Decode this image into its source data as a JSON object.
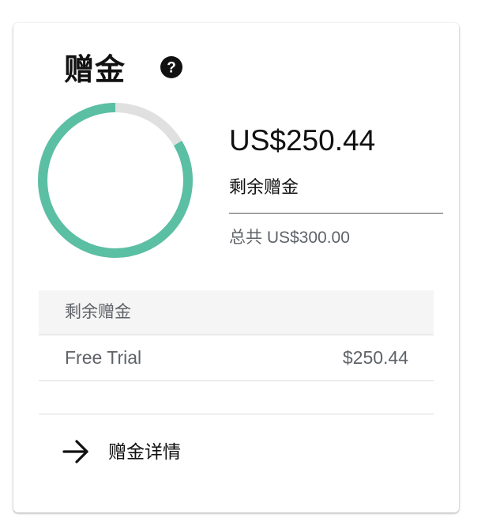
{
  "card": {
    "title": "赠金",
    "help_icon": "help-icon",
    "remaining_amount": "US$250.44",
    "remaining_label": "剩余赠金",
    "total_text": "总共 US$300.00",
    "remaining_fraction": 0.835,
    "colors": {
      "accent": "#5bbfa4",
      "track": "#e0e0e0"
    }
  },
  "table": {
    "header": "剩余赠金",
    "rows": [
      {
        "name": "Free Trial",
        "value": "$250.44"
      }
    ]
  },
  "footer": {
    "link_icon": "arrow-right-icon",
    "link_label": "赠金详情"
  }
}
